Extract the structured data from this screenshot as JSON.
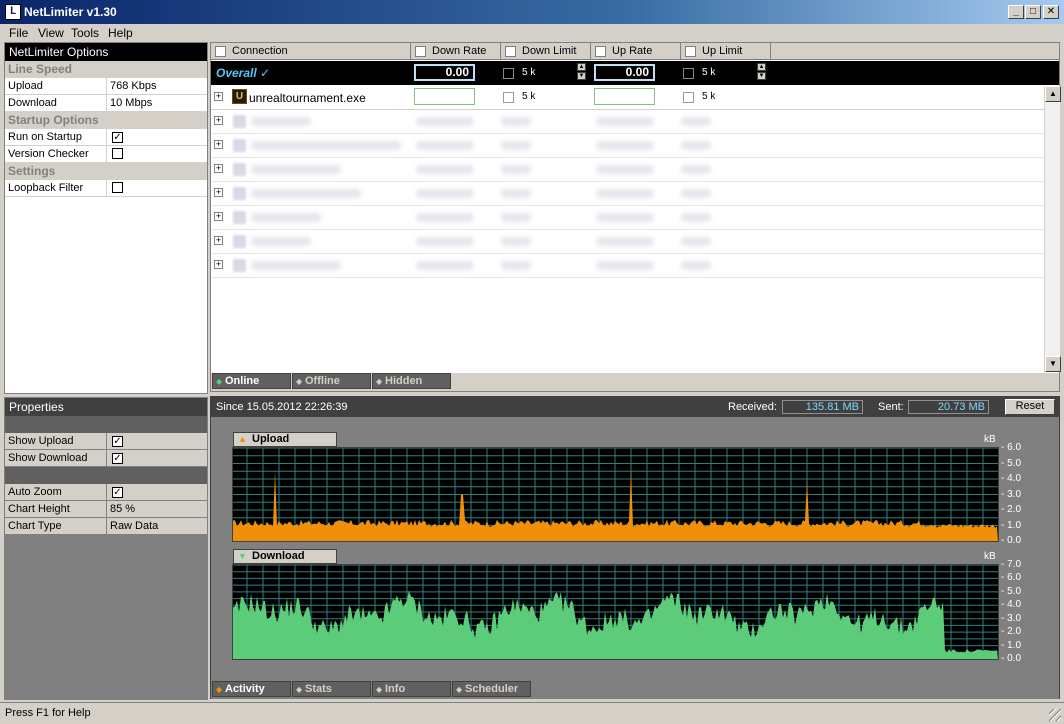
{
  "window": {
    "title": "NetLimiter v1.30",
    "icon": "netlimiter-logo-icon",
    "app_icon_letter": "L",
    "min_glyph": "_",
    "max_glyph": "□",
    "close_glyph": "✕"
  },
  "menu": [
    "File",
    "View",
    "Tools",
    "Help"
  ],
  "options_panel": {
    "title": "NetLimiter Options",
    "sections": [
      {
        "name": "Line Speed",
        "rows": [
          {
            "label": "Upload",
            "value": "768 Kbps"
          },
          {
            "label": "Download",
            "value": "10 Mbps"
          }
        ]
      },
      {
        "name": "Startup Options",
        "rows": [
          {
            "label": "Run on Startup",
            "checked": true
          },
          {
            "label": "Version Checker",
            "checked": false
          }
        ]
      },
      {
        "name": "Settings",
        "rows": [
          {
            "label": "Loopback Filter",
            "checked": false
          }
        ]
      }
    ]
  },
  "properties_panel": {
    "title": "Properties",
    "rows": [
      {
        "label": "Show Upload",
        "checked": true
      },
      {
        "label": "Show Download",
        "checked": true
      },
      {
        "label": "Auto Zoom",
        "checked": true
      },
      {
        "label": "Chart Height",
        "value": "85 %"
      },
      {
        "label": "Chart Type",
        "value": "Raw Data"
      }
    ]
  },
  "columns": [
    "Connection",
    "Down Rate",
    "Down Limit",
    "Up Rate",
    "Up Limit"
  ],
  "overall": {
    "label": "Overall",
    "check_glyph": "✓",
    "down_rate": "0.00",
    "down_limit": "5 k",
    "up_rate": "0.00",
    "up_limit": "5 k",
    "spin_up": "▲",
    "spin_down": "▼"
  },
  "connections": [
    {
      "name": "unrealtournament.exe",
      "icon": "unreal-tournament-icon",
      "icon_glyph": "U",
      "down_limit": "5 k",
      "up_limit": "5 k"
    }
  ],
  "expander_glyph": "+",
  "blurred_rows": 7,
  "scroll_up_glyph": "▲",
  "scroll_down_glyph": "▼",
  "list_tabs": [
    "Online",
    "Offline",
    "Hidden"
  ],
  "tab_icon_glyph": "◆",
  "activity": {
    "since": "Since 15.05.2012 22:26:39",
    "received_label": "Received:",
    "received": "135.81 MB",
    "sent_label": "Sent:",
    "sent": "20.73 MB",
    "reset_label": "Reset"
  },
  "bottom_tabs": [
    "Activity",
    "Stats",
    "Info",
    "Scheduler"
  ],
  "status": "Press F1 for Help",
  "chart_data": [
    {
      "type": "area",
      "title": "Upload",
      "title_icon_glyph": "▲",
      "unit": "kB",
      "ylim": [
        0,
        6
      ],
      "yticks": [
        "6.0",
        "5.0",
        "4.0",
        "3.0",
        "2.0",
        "1.0",
        "0.0"
      ],
      "grid": true,
      "color": "#f0900a",
      "baseline": 1.1,
      "spikes": [
        {
          "at": 0.055,
          "value": 4.5
        },
        {
          "at": 0.3,
          "value": 3.0
        },
        {
          "at": 0.52,
          "value": 4.6
        },
        {
          "at": 0.75,
          "value": 3.9
        }
      ],
      "tail_from": 0.92,
      "tail_value": 1.0
    },
    {
      "type": "area",
      "title": "Download",
      "title_icon_glyph": "▼",
      "unit": "kB",
      "ylim": [
        0,
        7
      ],
      "yticks": [
        "7.0",
        "6.0",
        "5.0",
        "4.0",
        "3.0",
        "2.0",
        "1.0",
        "0.0"
      ],
      "grid": true,
      "color": "#5ccb7a",
      "baseline": 3.3,
      "tail_from": 0.93,
      "tail_value": 0.6
    }
  ],
  "colors": {
    "titlebar": "#0a246a",
    "overall_text": "#5bc5f5",
    "received_text": "#7fd7ff",
    "chart_bg": "#000000",
    "grid": "#2f7f7f"
  }
}
